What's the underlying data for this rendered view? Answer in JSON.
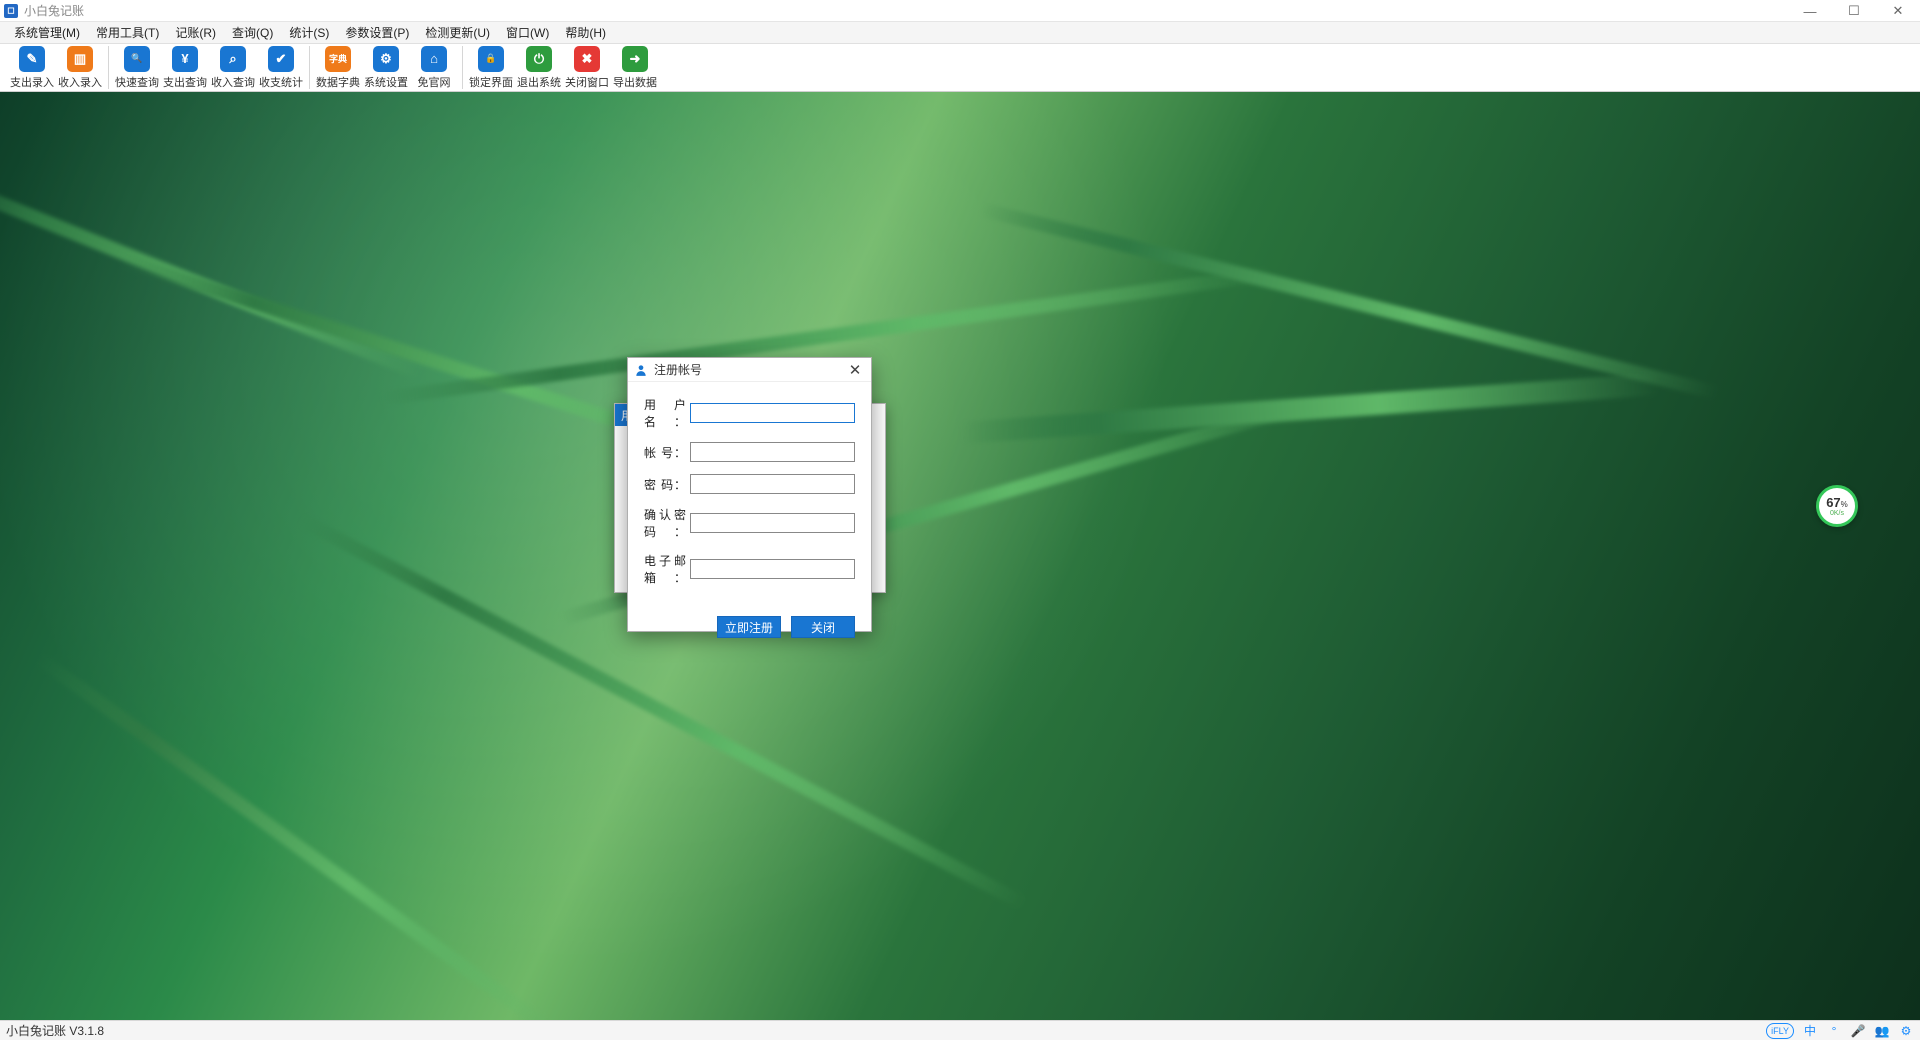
{
  "app": {
    "title": "小白兔记账"
  },
  "window_controls": {
    "min": "—",
    "max": "☐",
    "close": "✕"
  },
  "menus": [
    {
      "label": "系统管理(M)"
    },
    {
      "label": "常用工具(T)"
    },
    {
      "label": "记账(R)"
    },
    {
      "label": "查询(Q)"
    },
    {
      "label": "统计(S)"
    },
    {
      "label": "参数设置(P)"
    },
    {
      "label": "检测更新(U)"
    },
    {
      "label": "窗口(W)"
    },
    {
      "label": "帮助(H)"
    }
  ],
  "toolbar_groups": [
    {
      "items": [
        {
          "name": "expense-entry",
          "label": "支出录入",
          "icon": "edit-icon",
          "color": "ic-blue",
          "glyph": "✎"
        },
        {
          "name": "income-entry",
          "label": "收入录入",
          "icon": "folder-icon",
          "color": "ic-orn",
          "glyph": "▥"
        }
      ]
    },
    {
      "items": [
        {
          "name": "quick-query",
          "label": "快速查询",
          "icon": "search-icon",
          "color": "ic-blue",
          "glyph": "🔍"
        },
        {
          "name": "expense-query",
          "label": "支出查询",
          "icon": "yuan-search-icon",
          "color": "ic-blue",
          "glyph": "¥"
        },
        {
          "name": "income-query",
          "label": "收入查询",
          "icon": "list-search-icon",
          "color": "ic-blue",
          "glyph": "⌕"
        },
        {
          "name": "income-expense-stats",
          "label": "收支统计",
          "icon": "check-icon",
          "color": "ic-blue",
          "glyph": "✔"
        }
      ]
    },
    {
      "items": [
        {
          "name": "data-dictionary",
          "label": "数据字典",
          "icon": "dictionary-icon",
          "color": "ic-orn",
          "glyph": "字典"
        },
        {
          "name": "system-settings",
          "label": "系统设置",
          "icon": "gear-icon",
          "color": "ic-blue",
          "glyph": "⚙"
        },
        {
          "name": "official-site",
          "label": "免官网",
          "icon": "home-icon",
          "color": "ic-blue",
          "glyph": "⌂"
        }
      ]
    },
    {
      "items": [
        {
          "name": "lock-screen",
          "label": "锁定界面",
          "icon": "lock-icon",
          "color": "ic-blue",
          "glyph": "🔒"
        },
        {
          "name": "exit-system",
          "label": "退出系统",
          "icon": "power-icon",
          "color": "ic-green",
          "glyph": "⏻"
        },
        {
          "name": "close-window",
          "label": "关闭窗口",
          "icon": "close-icon",
          "color": "ic-red",
          "glyph": "✖"
        },
        {
          "name": "export-data",
          "label": "导出数据",
          "icon": "export-icon",
          "color": "ic-green",
          "glyph": "➜"
        }
      ]
    }
  ],
  "login_dialog": {
    "tab_label": "用"
  },
  "register_dialog": {
    "title": "注册帐号",
    "fields": {
      "username": {
        "label": "用 户  名",
        "value": ""
      },
      "account": {
        "label": "帐        号",
        "value": ""
      },
      "password": {
        "label": "密        码",
        "value": ""
      },
      "confirm": {
        "label": "确认密码",
        "value": ""
      },
      "email": {
        "label": "电子邮箱",
        "value": ""
      }
    },
    "buttons": {
      "register": "立即注册",
      "close": "关闭"
    }
  },
  "net_widget": {
    "percent": "67",
    "percent_unit": "%",
    "speed": "0K/s"
  },
  "statusbar": {
    "left": "小白兔记账 V3.1.8",
    "ime_badge": "iFLY",
    "lang": "中"
  }
}
